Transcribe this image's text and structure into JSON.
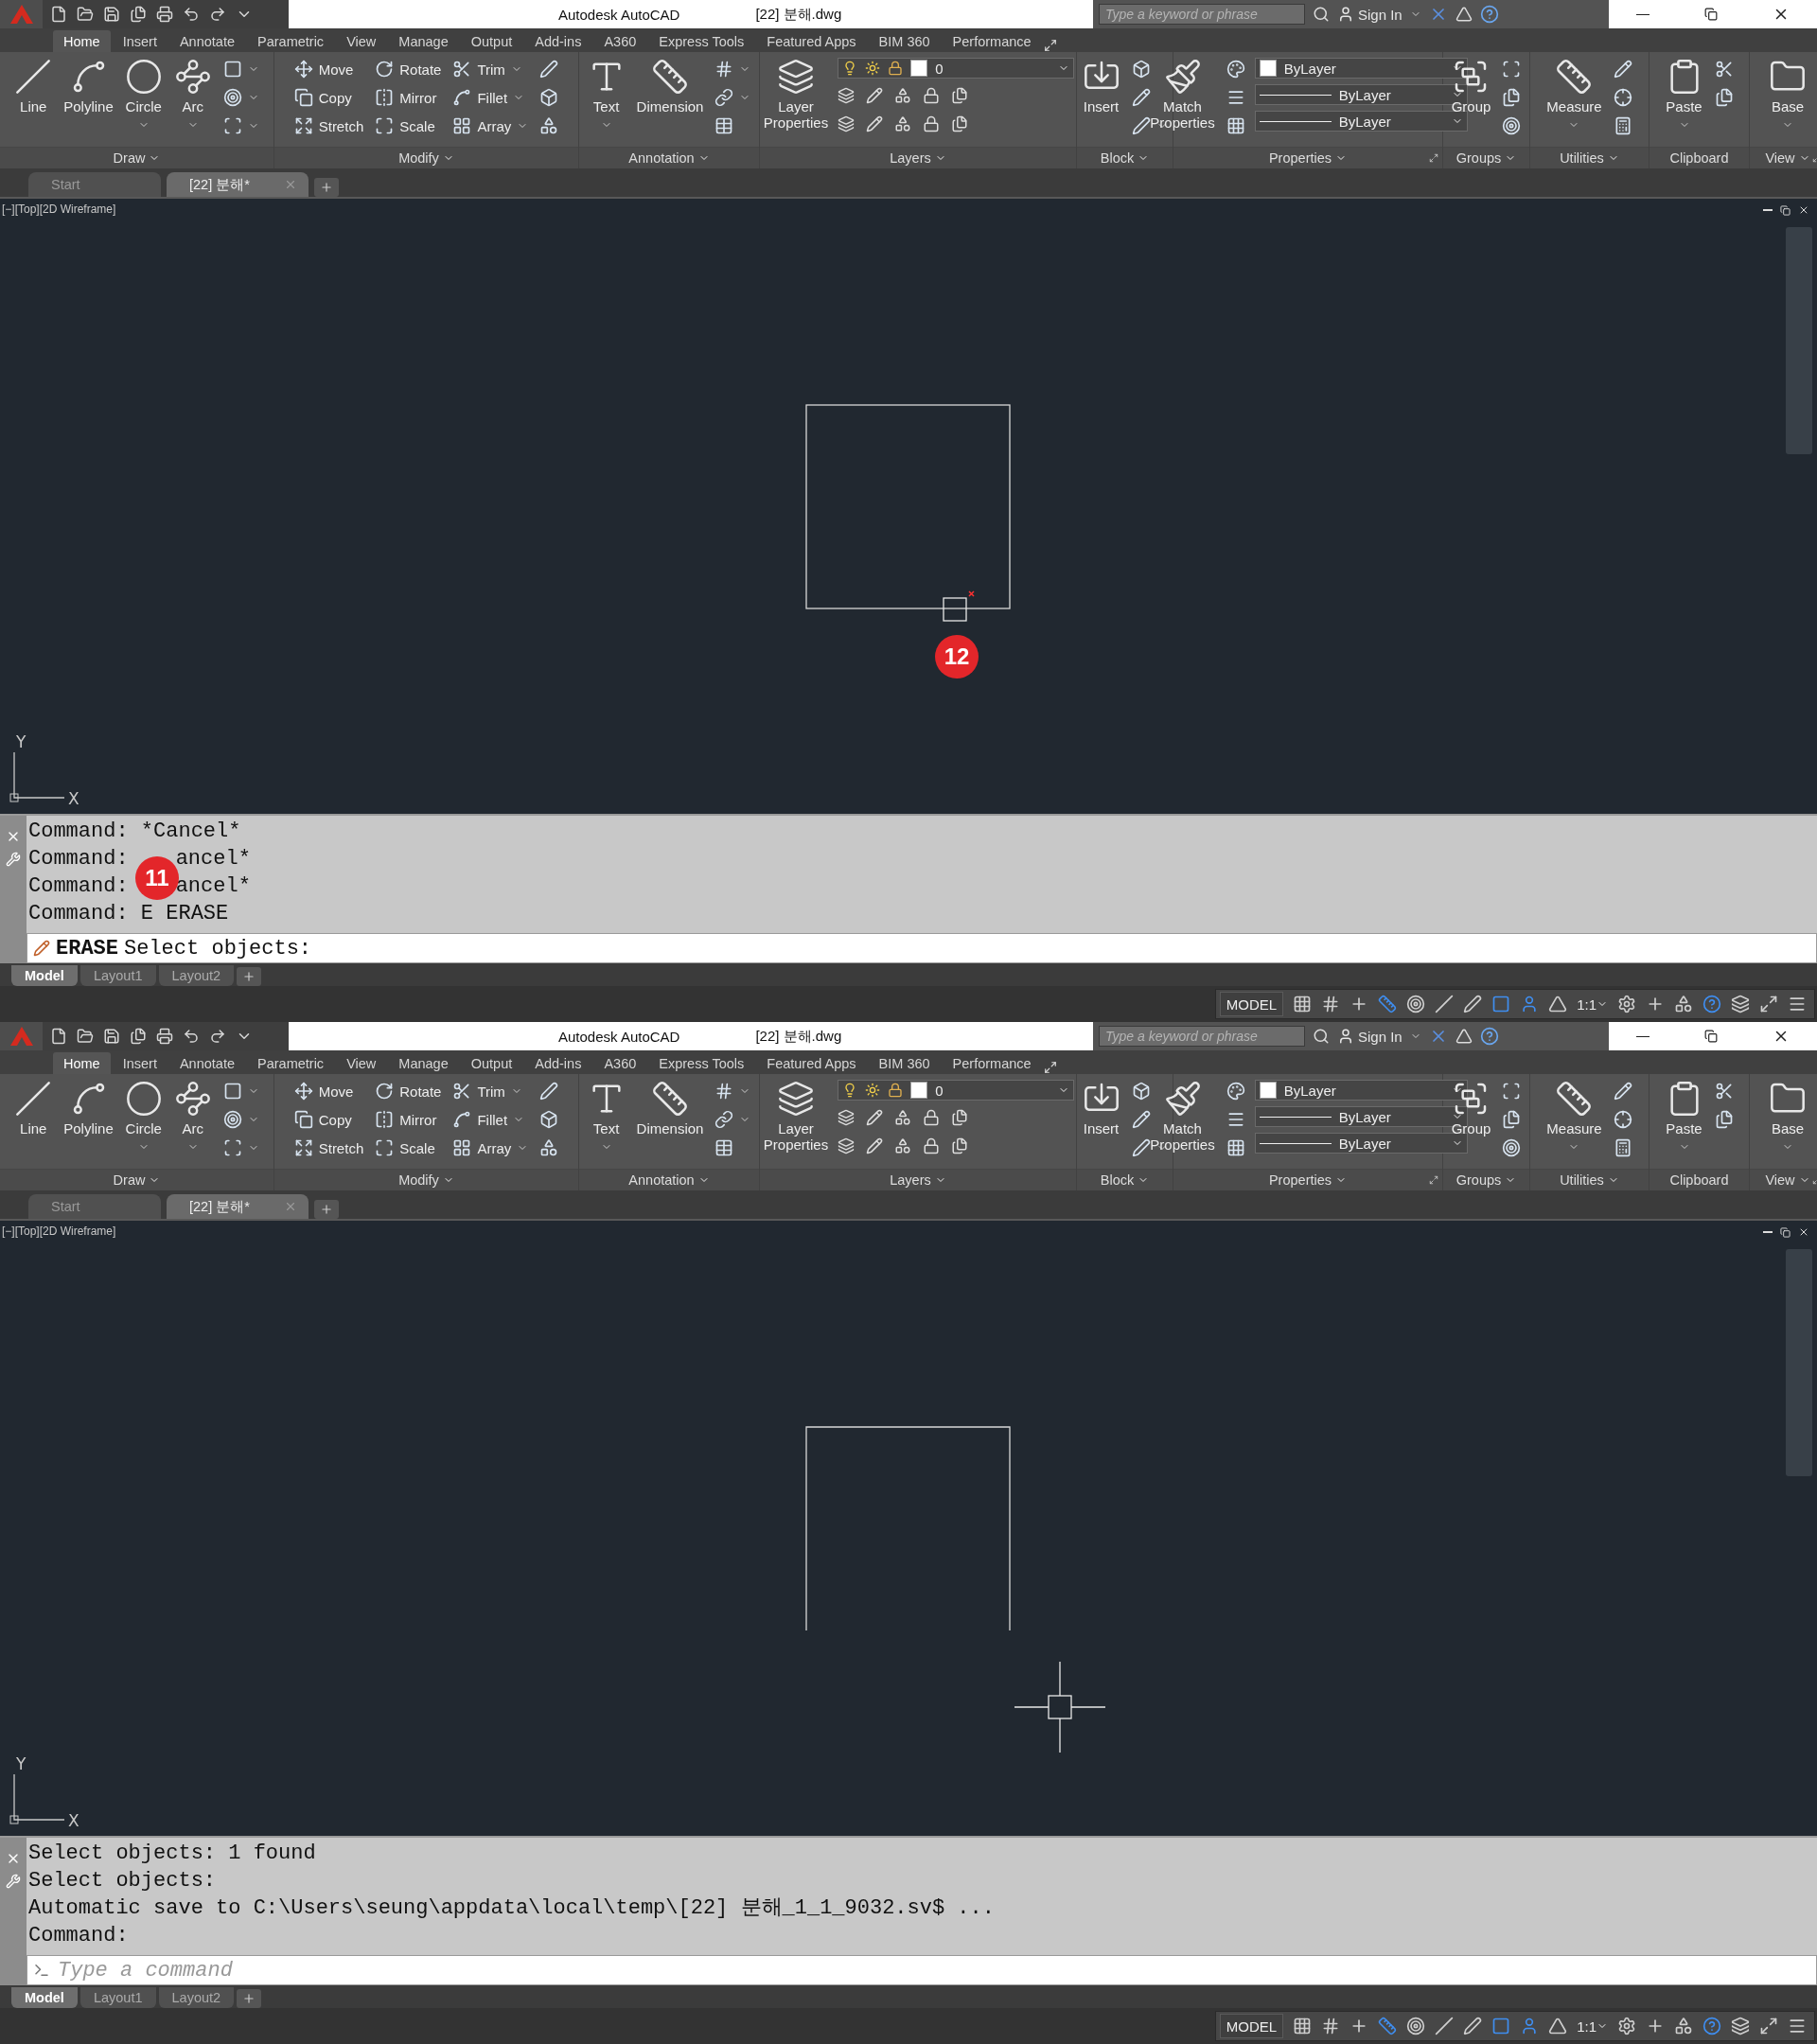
{
  "windows": [
    {
      "title_bar": {
        "app": "Autodesk AutoCAD",
        "file": "[22] 분해.dwg",
        "search_placeholder": "Type a keyword or phrase",
        "sign_in": "Sign In"
      },
      "ribbon_tabs": [
        {
          "label": "Home",
          "selected": true
        },
        {
          "label": "Insert",
          "selected": false
        },
        {
          "label": "Annotate",
          "selected": false
        },
        {
          "label": "Parametric",
          "selected": false
        },
        {
          "label": "View",
          "selected": false
        },
        {
          "label": "Manage",
          "selected": false
        },
        {
          "label": "Output",
          "selected": false
        },
        {
          "label": "Add-ins",
          "selected": false
        },
        {
          "label": "A360",
          "selected": false
        },
        {
          "label": "Express Tools",
          "selected": false
        },
        {
          "label": "Featured Apps",
          "selected": false
        },
        {
          "label": "BIM 360",
          "selected": false
        },
        {
          "label": "Performance",
          "selected": false
        }
      ],
      "panels": [
        {
          "title": "Draw",
          "menu": true,
          "launcher": false,
          "columns": [
            [
              {
                "kind": "large",
                "label": "Line",
                "dropdown": false
              }
            ],
            [
              {
                "kind": "large",
                "label": "Polyline",
                "dropdown": false
              }
            ],
            [
              {
                "kind": "large",
                "label": "Circle",
                "dropdown": true
              }
            ],
            [
              {
                "kind": "large",
                "label": "Arc",
                "dropdown": true
              }
            ],
            [
              {
                "kind": "small",
                "dropdown": true
              },
              {
                "kind": "small",
                "dropdown": true
              },
              {
                "kind": "small",
                "dropdown": true
              }
            ]
          ]
        },
        {
          "title": "Modify",
          "menu": true,
          "launcher": false,
          "columns": [
            [
              {
                "kind": "small",
                "label": "Move",
                "dropdown": false
              },
              {
                "kind": "small",
                "label": "Copy",
                "dropdown": false
              },
              {
                "kind": "small",
                "label": "Stretch",
                "dropdown": false
              }
            ],
            [
              {
                "kind": "small",
                "label": "Rotate",
                "dropdown": false
              },
              {
                "kind": "small",
                "label": "Mirror",
                "dropdown": false
              },
              {
                "kind": "small",
                "label": "Scale",
                "dropdown": false
              }
            ],
            [
              {
                "kind": "small",
                "label": "Trim",
                "dropdown": true
              },
              {
                "kind": "small",
                "label": "Fillet",
                "dropdown": true
              },
              {
                "kind": "small",
                "label": "Array",
                "dropdown": true
              }
            ],
            [
              {
                "kind": "small",
                "dropdown": false
              },
              {
                "kind": "small",
                "dropdown": false
              },
              {
                "kind": "small",
                "dropdown": false
              }
            ]
          ]
        },
        {
          "title": "Annotation",
          "menu": true,
          "launcher": false,
          "columns": [
            [
              {
                "kind": "large",
                "label": "Text",
                "dropdown": true
              }
            ],
            [
              {
                "kind": "large",
                "label": "Dimension",
                "dropdown": false
              }
            ],
            [
              {
                "kind": "small",
                "dropdown": true
              },
              {
                "kind": "small",
                "dropdown": true
              },
              {
                "kind": "small",
                "dropdown": false
              }
            ]
          ]
        },
        {
          "title": "Layers",
          "menu": true,
          "launcher": false,
          "columns": [
            [
              {
                "kind": "large",
                "label": "Layer Properties",
                "dropdown": false
              }
            ],
            [
              {
                "kind": "layer_combo",
                "value": "0"
              },
              {
                "kind": "icon_row"
              },
              {
                "kind": "icon_row"
              }
            ]
          ]
        },
        {
          "title": "Block",
          "menu": true,
          "launcher": false,
          "columns": [
            [
              {
                "kind": "large",
                "label": "Insert",
                "dropdown": false
              }
            ],
            [
              {
                "kind": "small",
                "dropdown": false
              },
              {
                "kind": "small",
                "dropdown": false
              },
              {
                "kind": "small",
                "dropdown": true
              }
            ]
          ]
        },
        {
          "title": "Properties",
          "menu": true,
          "launcher": true,
          "columns": [
            [
              {
                "kind": "large",
                "label": "Match Properties",
                "dropdown": false
              }
            ],
            [
              {
                "kind": "small",
                "dropdown": false
              },
              {
                "kind": "small",
                "dropdown": false
              },
              {
                "kind": "small",
                "dropdown": false
              }
            ],
            [
              {
                "kind": "combo",
                "value": "ByLayer",
                "swatch": true
              },
              {
                "kind": "combo",
                "value": "ByLayer",
                "swatch": false
              },
              {
                "kind": "combo",
                "value": "ByLayer",
                "swatch": false
              }
            ]
          ]
        },
        {
          "title": "Groups",
          "menu": true,
          "launcher": false,
          "columns": [
            [
              {
                "kind": "large",
                "label": "Group",
                "dropdown": false
              }
            ],
            [
              {
                "kind": "small",
                "dropdown": false
              },
              {
                "kind": "small",
                "dropdown": false
              },
              {
                "kind": "small",
                "dropdown": false
              }
            ]
          ]
        },
        {
          "title": "Utilities",
          "menu": true,
          "launcher": false,
          "columns": [
            [
              {
                "kind": "large",
                "label": "Measure",
                "dropdown": true
              }
            ],
            [
              {
                "kind": "small",
                "dropdown": false
              },
              {
                "kind": "small",
                "dropdown": false
              },
              {
                "kind": "small",
                "dropdown": false
              }
            ]
          ]
        },
        {
          "title": "Clipboard",
          "menu": false,
          "launcher": false,
          "columns": [
            [
              {
                "kind": "large",
                "label": "Paste",
                "dropdown": true
              }
            ],
            [
              {
                "kind": "small",
                "dropdown": false
              },
              {
                "kind": "small",
                "dropdown": false
              }
            ]
          ]
        },
        {
          "title": "View",
          "menu": true,
          "launcher": true,
          "columns": [
            [
              {
                "kind": "large",
                "label": "Base",
                "dropdown": true
              }
            ]
          ]
        }
      ],
      "file_tabs": [
        {
          "label": "Start",
          "selected": false
        },
        {
          "label": "[22] 분해*",
          "selected": true
        }
      ],
      "viewport": {
        "label": "[−][Top][2D Wireframe]",
        "bottom_edge": true,
        "pickbox_cursor": true,
        "axis_x": "X",
        "axis_y": "Y"
      },
      "command": {
        "history": [
          {
            "text": "Command: *Cancel*"
          },
          {
            "text": "Command:",
            "rest": "ancel*"
          },
          {
            "text": "Command:",
            "rest": "ancel*"
          },
          {
            "text": "Command: E ERASE"
          }
        ],
        "prompt_command": "ERASE",
        "prompt_text": "Select objects:"
      },
      "layout_tabs": [
        {
          "label": "Model",
          "selected": true
        },
        {
          "label": "Layout1",
          "selected": false
        },
        {
          "label": "Layout2",
          "selected": false
        }
      ],
      "status": {
        "model": "MODEL",
        "scale": "1:1"
      },
      "markers": [
        {
          "label": "12"
        },
        {
          "label": "11"
        }
      ]
    },
    {
      "title_bar": {
        "app": "Autodesk AutoCAD",
        "file": "[22] 분해.dwg",
        "search_placeholder": "Type a keyword or phrase",
        "sign_in": "Sign In"
      },
      "ribbon_tabs": [
        {
          "label": "Home",
          "selected": true
        },
        {
          "label": "Insert",
          "selected": false
        },
        {
          "label": "Annotate",
          "selected": false
        },
        {
          "label": "Parametric",
          "selected": false
        },
        {
          "label": "View",
          "selected": false
        },
        {
          "label": "Manage",
          "selected": false
        },
        {
          "label": "Output",
          "selected": false
        },
        {
          "label": "Add-ins",
          "selected": false
        },
        {
          "label": "A360",
          "selected": false
        },
        {
          "label": "Express Tools",
          "selected": false
        },
        {
          "label": "Featured Apps",
          "selected": false
        },
        {
          "label": "BIM 360",
          "selected": false
        },
        {
          "label": "Performance",
          "selected": false
        }
      ],
      "panels": [
        {
          "title": "Draw",
          "menu": true,
          "launcher": false,
          "columns": [
            [
              {
                "kind": "large",
                "label": "Line",
                "dropdown": false
              }
            ],
            [
              {
                "kind": "large",
                "label": "Polyline",
                "dropdown": false
              }
            ],
            [
              {
                "kind": "large",
                "label": "Circle",
                "dropdown": true
              }
            ],
            [
              {
                "kind": "large",
                "label": "Arc",
                "dropdown": true
              }
            ],
            [
              {
                "kind": "small",
                "dropdown": true
              },
              {
                "kind": "small",
                "dropdown": true
              },
              {
                "kind": "small",
                "dropdown": true
              }
            ]
          ]
        },
        {
          "title": "Modify",
          "menu": true,
          "launcher": false,
          "columns": [
            [
              {
                "kind": "small",
                "label": "Move",
                "dropdown": false
              },
              {
                "kind": "small",
                "label": "Copy",
                "dropdown": false
              },
              {
                "kind": "small",
                "label": "Stretch",
                "dropdown": false
              }
            ],
            [
              {
                "kind": "small",
                "label": "Rotate",
                "dropdown": false
              },
              {
                "kind": "small",
                "label": "Mirror",
                "dropdown": false
              },
              {
                "kind": "small",
                "label": "Scale",
                "dropdown": false
              }
            ],
            [
              {
                "kind": "small",
                "label": "Trim",
                "dropdown": true
              },
              {
                "kind": "small",
                "label": "Fillet",
                "dropdown": true
              },
              {
                "kind": "small",
                "label": "Array",
                "dropdown": true
              }
            ],
            [
              {
                "kind": "small",
                "dropdown": false
              },
              {
                "kind": "small",
                "dropdown": false
              },
              {
                "kind": "small",
                "dropdown": false
              }
            ]
          ]
        },
        {
          "title": "Annotation",
          "menu": true,
          "launcher": false,
          "columns": [
            [
              {
                "kind": "large",
                "label": "Text",
                "dropdown": true
              }
            ],
            [
              {
                "kind": "large",
                "label": "Dimension",
                "dropdown": false
              }
            ],
            [
              {
                "kind": "small",
                "dropdown": true
              },
              {
                "kind": "small",
                "dropdown": true
              },
              {
                "kind": "small",
                "dropdown": false
              }
            ]
          ]
        },
        {
          "title": "Layers",
          "menu": true,
          "launcher": false,
          "columns": [
            [
              {
                "kind": "large",
                "label": "Layer Properties",
                "dropdown": false
              }
            ],
            [
              {
                "kind": "layer_combo",
                "value": "0"
              },
              {
                "kind": "icon_row"
              },
              {
                "kind": "icon_row"
              }
            ]
          ]
        },
        {
          "title": "Block",
          "menu": true,
          "launcher": false,
          "columns": [
            [
              {
                "kind": "large",
                "label": "Insert",
                "dropdown": false
              }
            ],
            [
              {
                "kind": "small",
                "dropdown": false
              },
              {
                "kind": "small",
                "dropdown": false
              },
              {
                "kind": "small",
                "dropdown": true
              }
            ]
          ]
        },
        {
          "title": "Properties",
          "menu": true,
          "launcher": true,
          "columns": [
            [
              {
                "kind": "large",
                "label": "Match Properties",
                "dropdown": false
              }
            ],
            [
              {
                "kind": "small",
                "dropdown": false
              },
              {
                "kind": "small",
                "dropdown": false
              },
              {
                "kind": "small",
                "dropdown": false
              }
            ],
            [
              {
                "kind": "combo",
                "value": "ByLayer",
                "swatch": true
              },
              {
                "kind": "combo",
                "value": "ByLayer",
                "swatch": false
              },
              {
                "kind": "combo",
                "value": "ByLayer",
                "swatch": false
              }
            ]
          ]
        },
        {
          "title": "Groups",
          "menu": true,
          "launcher": false,
          "columns": [
            [
              {
                "kind": "large",
                "label": "Group",
                "dropdown": false
              }
            ],
            [
              {
                "kind": "small",
                "dropdown": false
              },
              {
                "kind": "small",
                "dropdown": false
              },
              {
                "kind": "small",
                "dropdown": false
              }
            ]
          ]
        },
        {
          "title": "Utilities",
          "menu": true,
          "launcher": false,
          "columns": [
            [
              {
                "kind": "large",
                "label": "Measure",
                "dropdown": true
              }
            ],
            [
              {
                "kind": "small",
                "dropdown": false
              },
              {
                "kind": "small",
                "dropdown": false
              },
              {
                "kind": "small",
                "dropdown": false
              }
            ]
          ]
        },
        {
          "title": "Clipboard",
          "menu": false,
          "launcher": false,
          "columns": [
            [
              {
                "kind": "large",
                "label": "Paste",
                "dropdown": true
              }
            ],
            [
              {
                "kind": "small",
                "dropdown": false
              },
              {
                "kind": "small",
                "dropdown": false
              }
            ]
          ]
        },
        {
          "title": "View",
          "menu": true,
          "launcher": true,
          "columns": [
            [
              {
                "kind": "large",
                "label": "Base",
                "dropdown": true
              }
            ]
          ]
        }
      ],
      "file_tabs": [
        {
          "label": "Start",
          "selected": false
        },
        {
          "label": "[22] 분해*",
          "selected": true
        }
      ],
      "viewport": {
        "label": "[−][Top][2D Wireframe]",
        "bottom_edge": false,
        "crosshair_cursor": true,
        "axis_x": "X",
        "axis_y": "Y"
      },
      "command": {
        "history": [
          {
            "text": "Select objects: 1 found"
          },
          {
            "text": "Select objects:"
          },
          {
            "text": "Automatic save to C:\\Users\\seung\\appdata\\local\\temp\\[22] 분해_1_1_9032.sv$ ..."
          },
          {
            "text": "Command:"
          }
        ],
        "placeholder": "Type a command"
      },
      "layout_tabs": [
        {
          "label": "Model",
          "selected": true
        },
        {
          "label": "Layout1",
          "selected": false
        },
        {
          "label": "Layout2",
          "selected": false
        }
      ],
      "status": {
        "model": "MODEL",
        "scale": "1:1"
      }
    }
  ]
}
